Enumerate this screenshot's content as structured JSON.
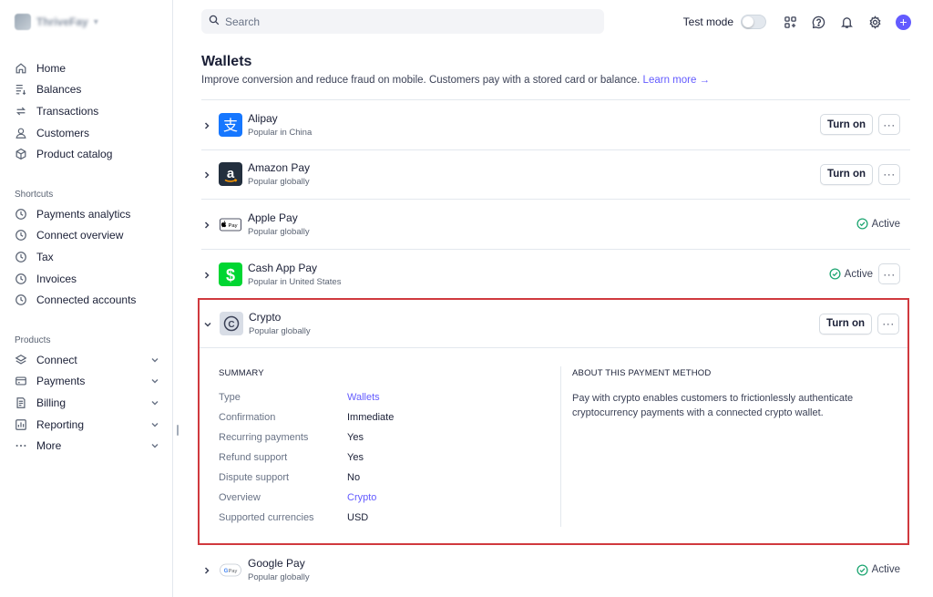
{
  "brand": {
    "name": "ThriveFay"
  },
  "sidebar": {
    "main_items": [
      {
        "label": "Home",
        "icon": "home-icon"
      },
      {
        "label": "Balances",
        "icon": "balances-icon"
      },
      {
        "label": "Transactions",
        "icon": "transactions-icon"
      },
      {
        "label": "Customers",
        "icon": "customers-icon"
      },
      {
        "label": "Product catalog",
        "icon": "product-catalog-icon"
      }
    ],
    "shortcuts_title": "Shortcuts",
    "shortcuts": [
      {
        "label": "Payments analytics",
        "icon": "clock-icon"
      },
      {
        "label": "Connect overview",
        "icon": "clock-icon"
      },
      {
        "label": "Tax",
        "icon": "clock-icon"
      },
      {
        "label": "Invoices",
        "icon": "clock-icon"
      },
      {
        "label": "Connected accounts",
        "icon": "clock-icon"
      }
    ],
    "products_title": "Products",
    "products": [
      {
        "label": "Connect",
        "icon": "connect-icon"
      },
      {
        "label": "Payments",
        "icon": "payments-icon"
      },
      {
        "label": "Billing",
        "icon": "billing-icon"
      },
      {
        "label": "Reporting",
        "icon": "reporting-icon"
      },
      {
        "label": "More",
        "icon": "more-icon"
      }
    ]
  },
  "search": {
    "placeholder": "Search"
  },
  "topbar": {
    "test_mode_label": "Test mode",
    "test_mode_on": false
  },
  "page": {
    "title": "Wallets",
    "subtitle": "Improve conversion and reduce fraud on mobile. Customers pay with a stored card or balance.",
    "learn_more": "Learn more →"
  },
  "methods": [
    {
      "name": "Alipay",
      "sub": "Popular in China",
      "action": "Turn on",
      "status": ""
    },
    {
      "name": "Amazon Pay",
      "sub": "Popular globally",
      "action": "Turn on",
      "status": ""
    },
    {
      "name": "Apple Pay",
      "sub": "Popular globally",
      "action": "",
      "status": "Active"
    },
    {
      "name": "Cash App Pay",
      "sub": "Popular in United States",
      "action": "",
      "status": "Active"
    },
    {
      "name": "Crypto",
      "sub": "Popular globally",
      "action": "Turn on",
      "status": ""
    },
    {
      "name": "Google Pay",
      "sub": "Popular globally",
      "action": "",
      "status": "Active"
    }
  ],
  "crypto_details": {
    "summary_title": "SUMMARY",
    "rows": [
      {
        "key": "Type",
        "value": "Wallets"
      },
      {
        "key": "Confirmation",
        "value": "Immediate"
      },
      {
        "key": "Recurring payments",
        "value": "Yes"
      },
      {
        "key": "Refund support",
        "value": "Yes"
      },
      {
        "key": "Dispute support",
        "value": "No"
      },
      {
        "key": "Overview",
        "value": "Crypto"
      },
      {
        "key": "Supported currencies",
        "value": "USD"
      }
    ],
    "about_title": "ABOUT THIS PAYMENT METHOD",
    "about_text": "Pay with crypto enables customers to frictionlessly authenticate cryptocurrency payments with a connected crypto wallet."
  },
  "colors": {
    "accent": "#635bff",
    "highlight_border": "#d0393e",
    "active_green": "#1ea672"
  }
}
